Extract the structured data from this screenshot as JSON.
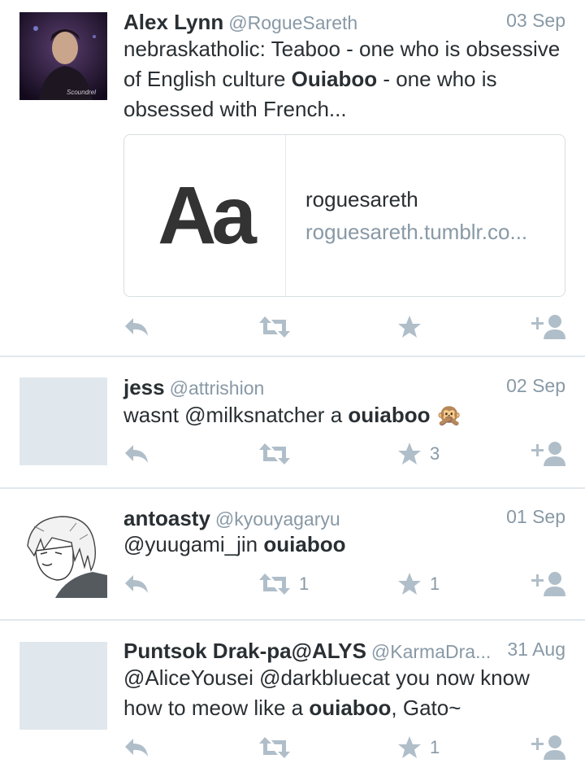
{
  "tweets": [
    {
      "name": "Alex Lynn",
      "handle": "@RogueSareth",
      "date": "03 Sep",
      "avatar_caption": "Scoundrel",
      "text_parts": [
        {
          "t": "nebraskatholic: Teaboo - one who is obsessive of English culture ",
          "b": false
        },
        {
          "t": "Ouiaboo",
          "b": true
        },
        {
          "t": " - one who is obsessed with French...",
          "b": false
        }
      ],
      "card": {
        "thumb_text": "Aa",
        "title": "roguesareth",
        "url": "roguesareth.tumblr.co..."
      },
      "retweets": "",
      "favorites": ""
    },
    {
      "name": "jess",
      "handle": "@attrishion",
      "date": "02 Sep",
      "text_parts": [
        {
          "t": "wasnt @milksnatcher a ",
          "b": false
        },
        {
          "t": "ouiaboo",
          "b": true
        },
        {
          "t": " ",
          "b": false
        },
        {
          "t": "🙊",
          "b": false
        }
      ],
      "retweets": "",
      "favorites": "3"
    },
    {
      "name": "antoasty",
      "handle": "@kyouyagaryu",
      "date": "01 Sep",
      "text_parts": [
        {
          "t": "@yuugami_jin ",
          "b": false
        },
        {
          "t": "ouiaboo",
          "b": true
        }
      ],
      "retweets": "1",
      "favorites": "1"
    },
    {
      "name": "Puntsok Drak-pa@ALYS",
      "handle": "@KarmaDra...",
      "date": "31 Aug",
      "text_parts": [
        {
          "t": "@AliceYousei @darkbluecat you now know how to meow like a ",
          "b": false
        },
        {
          "t": "ouiaboo",
          "b": true
        },
        {
          "t": ", Gato~",
          "b": false
        }
      ],
      "retweets": "",
      "favorites": "1"
    }
  ],
  "icons": {
    "reply": "reply-icon",
    "retweet": "retweet-icon",
    "favorite": "star-icon",
    "follow": "follow-icon"
  },
  "colors": {
    "icon": "#b0bec9",
    "muted_text": "#8899a6",
    "divider": "#e1e8ed",
    "placeholder_avatar": "#e1e8ed"
  }
}
